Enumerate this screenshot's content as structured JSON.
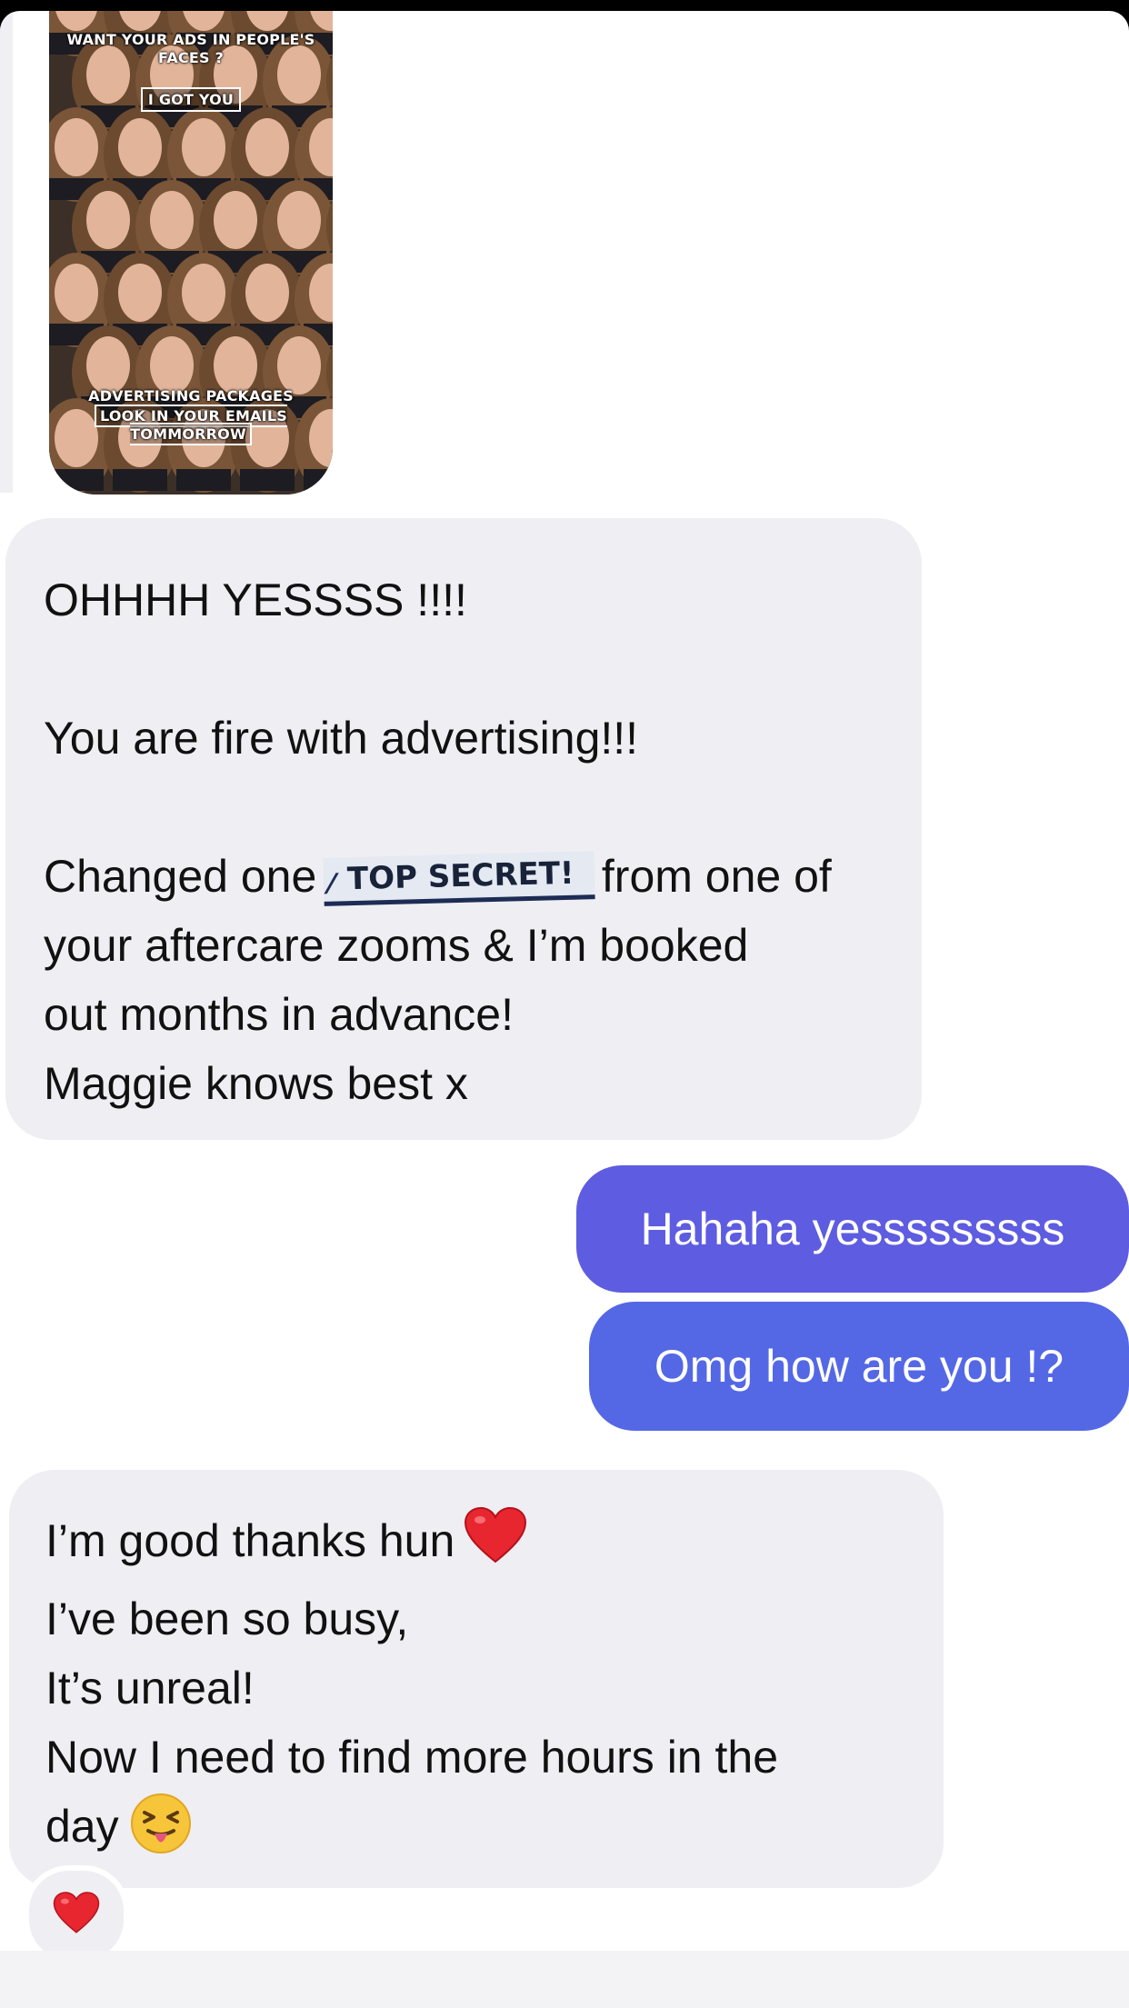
{
  "story": {
    "caption_top": "WANT YOUR ADS IN PEOPLE'S FACES ?",
    "caption_mid": "I GOT YOU",
    "caption_bottom_1": "ADVERTISING PACKAGES",
    "caption_bottom_2": "LOOK IN YOUR EMAILS TOMMORROW"
  },
  "messages": {
    "received_1": {
      "line1": "OHHHH YESSSS !!!!",
      "line2": "You are fire with advertising!!!",
      "line3_pre": "Changed one",
      "redaction_sticker": "TOP SECRET!",
      "line3_post": "from one of",
      "line4": "your aftercare zooms & I’m booked",
      "line5": "out months in advance!",
      "line6": "Maggie knows best x"
    },
    "sent_1": "Hahaha yesssssssss",
    "sent_2": "Omg how are you !?",
    "received_2": {
      "line1": "I’m good thanks hun",
      "line2": "I’ve been so busy,",
      "line3": "It’s unreal!",
      "line4": "Now I need to find more hours in the",
      "line5": "day"
    }
  },
  "icons": {
    "inline_heart": "red-heart-emoji",
    "inline_face": "squinting-face-with-tongue-emoji",
    "reaction": "red-heart-reaction"
  },
  "colors": {
    "received_bubble": "#efeef3",
    "sent_bubble_top": "#5e5ce0",
    "sent_bubble_bottom": "#5468e6",
    "heart": "#e8262f"
  }
}
